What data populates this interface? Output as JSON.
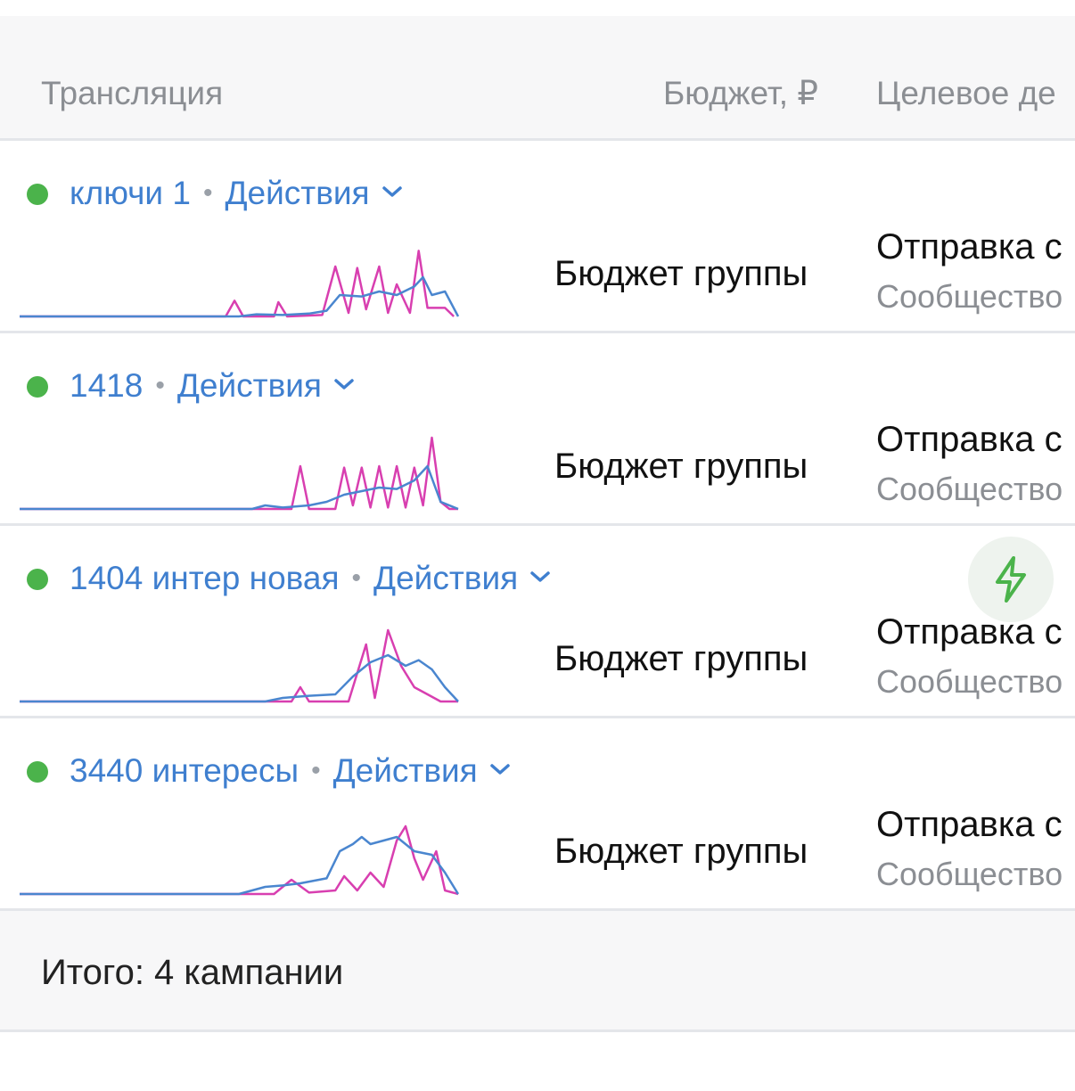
{
  "header": {
    "col_name": "Трансляция",
    "col_budget": "Бюджет, ₽",
    "col_target": "Целевое де"
  },
  "rows": [
    {
      "name": "ключи 1",
      "separator": "•",
      "actions": "Действия",
      "status_color": "#4bb34b",
      "budget": "Бюджет группы",
      "target_main": "Отправка с",
      "target_sub": "Сообщество",
      "has_bolt": false,
      "spark_pink": [
        0,
        0,
        0,
        0,
        0,
        0,
        0,
        0,
        0,
        0,
        0,
        0,
        0,
        0,
        0,
        0,
        0,
        0,
        0,
        0,
        0,
        0,
        0,
        0,
        0,
        0,
        0,
        0,
        0,
        0,
        0,
        0,
        0,
        0,
        0,
        0,
        0,
        0,
        0,
        0,
        0,
        0,
        0,
        0,
        0,
        0,
        0,
        0,
        0,
        0,
        0,
        0,
        0,
        0,
        0,
        0,
        0,
        0,
        0,
        0,
        0,
        0,
        0,
        0,
        0,
        0,
        0,
        0,
        0,
        0,
        0,
        0,
        0,
        0,
        0,
        0,
        0,
        0,
        0,
        0,
        0,
        0,
        0,
        0,
        0,
        0,
        0,
        0,
        0,
        0,
        0,
        0,
        0,
        0,
        0,
        0,
        0,
        0,
        0,
        0,
        0,
        0,
        0,
        0,
        0,
        0,
        0,
        0,
        0,
        0,
        0,
        0,
        0,
        0,
        0,
        0,
        0,
        0,
        0,
        0,
        0,
        0,
        0,
        0,
        0,
        0,
        0,
        0,
        0,
        0,
        0,
        0,
        0,
        0,
        0,
        0,
        0,
        0,
        0,
        0,
        0,
        0,
        0,
        0,
        0,
        0,
        0,
        0,
        0,
        0,
        0,
        0,
        0,
        0,
        0,
        0,
        0,
        0,
        0,
        0,
        0,
        0,
        0,
        0,
        0,
        0,
        0,
        0,
        0,
        0,
        0,
        0,
        0,
        0,
        0,
        0,
        0,
        0,
        0,
        0,
        0,
        0,
        0,
        0,
        0,
        0,
        0,
        0,
        0,
        0,
        0,
        0,
        0,
        0,
        0,
        0,
        0,
        0,
        0,
        0,
        0,
        0,
        0,
        0,
        0,
        0,
        0,
        0,
        0,
        0,
        0,
        0,
        0,
        0,
        0,
        0,
        0,
        0,
        0,
        0,
        0,
        0,
        0,
        0,
        0,
        0,
        0,
        0,
        0,
        0,
        0,
        0,
        0,
        0,
        0,
        0,
        0,
        0,
        0,
        0,
        0,
        0,
        0,
        0,
        0,
        0,
        0,
        0,
        0,
        0,
        0,
        0,
        0,
        0,
        0,
        0,
        0,
        0,
        0,
        0,
        0,
        0,
        0,
        0,
        0,
        0,
        0,
        0,
        0,
        0,
        0,
        0,
        0,
        0,
        0,
        0,
        0,
        0,
        0,
        0,
        0,
        0,
        0,
        0,
        0,
        0,
        0,
        0,
        0,
        0,
        0,
        0,
        0,
        0,
        0,
        0,
        0,
        0,
        0,
        0,
        0,
        0,
        0,
        0,
        0,
        0,
        0,
        0,
        0,
        0,
        0,
        0,
        0,
        0,
        0,
        0,
        0,
        0,
        0,
        0,
        0,
        0,
        0,
        0,
        0,
        0,
        0,
        0,
        0,
        0,
        0,
        0,
        0,
        0,
        0,
        0,
        0,
        0,
        0,
        0,
        0,
        0,
        0,
        0,
        0,
        0,
        0,
        0,
        0,
        0,
        0,
        0,
        0,
        0,
        0,
        0,
        0,
        0,
        0,
        0,
        0,
        0,
        0,
        0,
        0,
        0,
        0,
        0,
        0,
        0,
        0,
        0,
        0,
        0,
        0,
        0,
        0,
        0,
        0,
        0,
        0,
        0,
        0,
        0,
        0,
        0,
        0,
        0,
        0,
        0,
        0,
        0,
        0,
        0,
        0,
        0,
        0,
        0,
        0,
        0,
        0,
        0,
        0,
        0,
        0,
        0,
        0,
        0,
        0,
        0,
        0,
        0,
        0,
        0,
        0,
        0,
        0,
        0,
        0,
        0,
        0,
        0,
        0,
        0,
        0,
        0,
        0,
        0,
        0,
        0,
        0,
        0,
        0,
        0,
        0,
        0,
        0,
        0,
        0,
        0,
        0,
        0,
        0,
        0,
        0,
        0,
        0,
        0,
        0,
        0,
        0,
        0,
        0,
        0,
        0,
        0,
        0,
        0,
        0,
        0,
        0,
        0,
        0,
        0,
        0,
        0,
        0,
        0,
        0,
        0,
        0,
        0,
        0,
        0,
        0,
        0,
        0,
        0,
        0,
        0,
        0,
        0,
        0,
        0,
        0,
        0,
        0,
        0,
        0,
        0,
        0,
        0,
        0,
        0,
        0,
        0,
        0,
        0,
        0,
        0,
        0,
        0,
        0,
        0,
        0,
        0,
        0,
        0,
        0,
        0,
        0,
        0,
        0,
        0,
        0,
        0,
        0,
        0,
        0,
        0,
        0,
        0,
        0,
        0,
        0,
        0,
        0,
        0,
        0,
        0,
        0,
        0,
        0,
        0,
        0,
        0,
        0,
        0,
        0,
        0,
        0,
        0,
        0,
        0,
        0,
        0,
        0,
        0
      ],
      "spark_pink_pts": [
        [
          0,
          0
        ],
        [
          0.47,
          0
        ],
        [
          0.49,
          0.22
        ],
        [
          0.51,
          0
        ],
        [
          0.58,
          0
        ],
        [
          0.59,
          0.2
        ],
        [
          0.61,
          0
        ],
        [
          0.69,
          0.02
        ],
        [
          0.72,
          0.7
        ],
        [
          0.75,
          0.05
        ],
        [
          0.77,
          0.68
        ],
        [
          0.79,
          0.1
        ],
        [
          0.82,
          0.7
        ],
        [
          0.84,
          0.05
        ],
        [
          0.86,
          0.45
        ],
        [
          0.89,
          0.05
        ],
        [
          0.91,
          0.92
        ],
        [
          0.93,
          0.12
        ],
        [
          0.97,
          0.12
        ],
        [
          0.99,
          0
        ]
      ],
      "spark_blue_pts": [
        [
          0,
          0
        ],
        [
          0.5,
          0
        ],
        [
          0.54,
          0.03
        ],
        [
          0.6,
          0.02
        ],
        [
          0.66,
          0.04
        ],
        [
          0.7,
          0.08
        ],
        [
          0.73,
          0.3
        ],
        [
          0.78,
          0.28
        ],
        [
          0.82,
          0.35
        ],
        [
          0.86,
          0.3
        ],
        [
          0.9,
          0.42
        ],
        [
          0.92,
          0.55
        ],
        [
          0.94,
          0.3
        ],
        [
          0.97,
          0.35
        ],
        [
          1,
          0
        ]
      ]
    },
    {
      "name": "1418",
      "separator": "•",
      "actions": "Действия",
      "status_color": "#4bb34b",
      "budget": "Бюджет группы",
      "target_main": "Отправка с",
      "target_sub": "Сообщество",
      "has_bolt": false,
      "spark_pink_pts": [
        [
          0,
          0
        ],
        [
          0.62,
          0
        ],
        [
          0.64,
          0.6
        ],
        [
          0.66,
          0
        ],
        [
          0.72,
          0
        ],
        [
          0.74,
          0.58
        ],
        [
          0.76,
          0.05
        ],
        [
          0.78,
          0.58
        ],
        [
          0.8,
          0.02
        ],
        [
          0.82,
          0.6
        ],
        [
          0.84,
          0.02
        ],
        [
          0.86,
          0.6
        ],
        [
          0.88,
          0.02
        ],
        [
          0.9,
          0.58
        ],
        [
          0.92,
          0.05
        ],
        [
          0.94,
          1.0
        ],
        [
          0.96,
          0.1
        ],
        [
          0.98,
          0
        ],
        [
          1,
          0
        ]
      ],
      "spark_blue_pts": [
        [
          0,
          0
        ],
        [
          0.53,
          0
        ],
        [
          0.56,
          0.05
        ],
        [
          0.6,
          0.02
        ],
        [
          0.66,
          0.05
        ],
        [
          0.7,
          0.1
        ],
        [
          0.74,
          0.2
        ],
        [
          0.78,
          0.25
        ],
        [
          0.82,
          0.3
        ],
        [
          0.86,
          0.28
        ],
        [
          0.9,
          0.4
        ],
        [
          0.93,
          0.6
        ],
        [
          0.96,
          0.1
        ],
        [
          1,
          0
        ]
      ]
    },
    {
      "name": "1404 интер новая",
      "separator": "•",
      "actions": "Действия",
      "status_color": "#4bb34b",
      "budget": "Бюджет группы",
      "target_main": "Отправка с",
      "target_sub": "Сообщество",
      "has_bolt": true,
      "spark_pink_pts": [
        [
          0,
          0
        ],
        [
          0.62,
          0
        ],
        [
          0.64,
          0.2
        ],
        [
          0.66,
          0
        ],
        [
          0.75,
          0
        ],
        [
          0.79,
          0.8
        ],
        [
          0.81,
          0.05
        ],
        [
          0.84,
          1.0
        ],
        [
          0.87,
          0.5
        ],
        [
          0.9,
          0.2
        ],
        [
          0.93,
          0.1
        ],
        [
          0.96,
          0
        ],
        [
          1,
          0
        ]
      ],
      "spark_blue_pts": [
        [
          0,
          0
        ],
        [
          0.56,
          0
        ],
        [
          0.6,
          0.05
        ],
        [
          0.66,
          0.08
        ],
        [
          0.72,
          0.1
        ],
        [
          0.76,
          0.35
        ],
        [
          0.8,
          0.55
        ],
        [
          0.84,
          0.65
        ],
        [
          0.88,
          0.5
        ],
        [
          0.91,
          0.58
        ],
        [
          0.94,
          0.45
        ],
        [
          0.97,
          0.2
        ],
        [
          1,
          0
        ]
      ]
    },
    {
      "name": "3440 интересы",
      "separator": "•",
      "actions": "Действия",
      "status_color": "#4bb34b",
      "budget": "Бюджет группы",
      "target_main": "Отправка с",
      "target_sub": "Сообщество",
      "has_bolt": false,
      "spark_pink_pts": [
        [
          0,
          0
        ],
        [
          0.58,
          0
        ],
        [
          0.62,
          0.2
        ],
        [
          0.66,
          0.02
        ],
        [
          0.72,
          0.05
        ],
        [
          0.74,
          0.25
        ],
        [
          0.77,
          0.05
        ],
        [
          0.8,
          0.3
        ],
        [
          0.83,
          0.1
        ],
        [
          0.86,
          0.75
        ],
        [
          0.88,
          0.95
        ],
        [
          0.9,
          0.5
        ],
        [
          0.92,
          0.2
        ],
        [
          0.95,
          0.6
        ],
        [
          0.97,
          0.05
        ],
        [
          1,
          0
        ]
      ],
      "spark_blue_pts": [
        [
          0,
          0
        ],
        [
          0.5,
          0
        ],
        [
          0.56,
          0.1
        ],
        [
          0.6,
          0.12
        ],
        [
          0.64,
          0.15
        ],
        [
          0.7,
          0.22
        ],
        [
          0.73,
          0.6
        ],
        [
          0.76,
          0.7
        ],
        [
          0.78,
          0.8
        ],
        [
          0.8,
          0.7
        ],
        [
          0.83,
          0.75
        ],
        [
          0.86,
          0.8
        ],
        [
          0.9,
          0.6
        ],
        [
          0.94,
          0.55
        ],
        [
          0.97,
          0.3
        ],
        [
          1,
          0
        ]
      ]
    }
  ],
  "footer": {
    "total": "Итого: 4 кампании"
  },
  "colors": {
    "link": "#3f7fcf",
    "status_active": "#4bb34b",
    "spark_pink": "#d83fb0",
    "spark_blue": "#4a86cf"
  },
  "icons": {
    "chevron": "chevron-down-icon",
    "bolt": "lightning-icon",
    "status": "status-dot-icon"
  }
}
